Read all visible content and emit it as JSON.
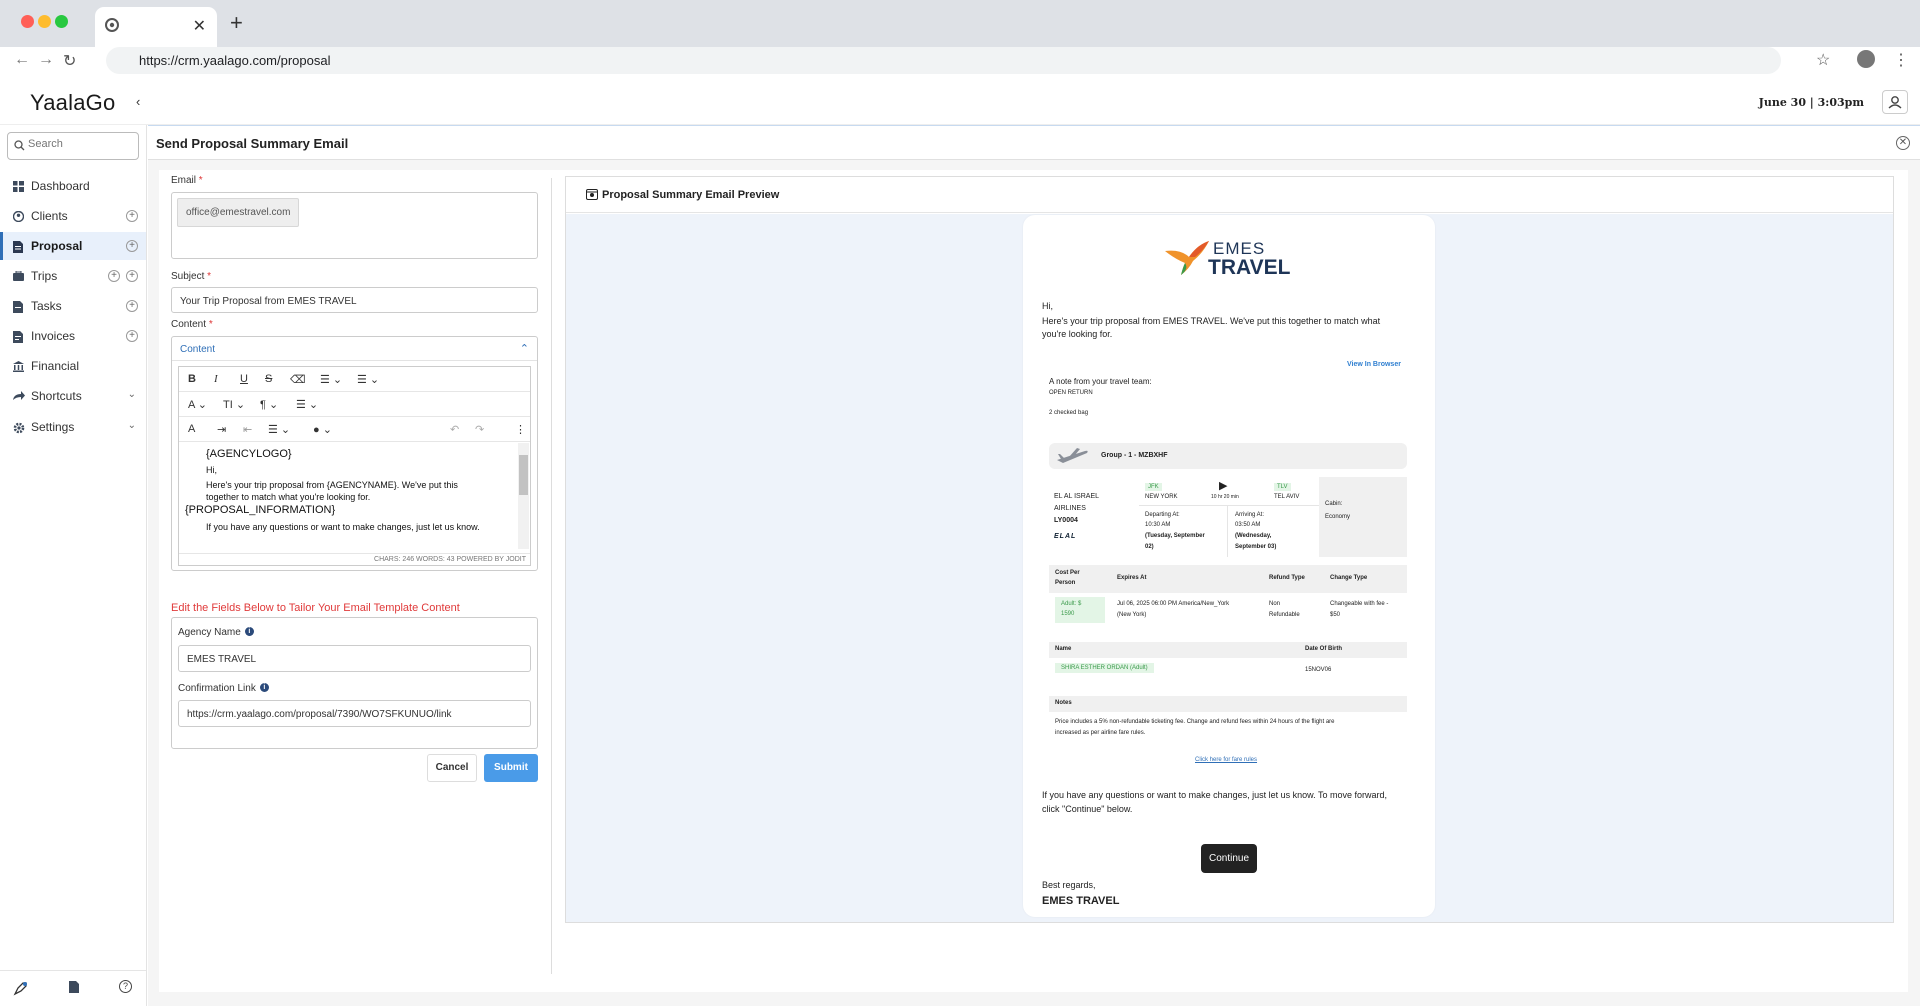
{
  "browser": {
    "url": "https://crm.yaalago.com/proposal"
  },
  "app": {
    "logo": "YaalaGo",
    "datetime": "June 30 | 3:03pm"
  },
  "sidebar": {
    "search_placeholder": "Search",
    "items": [
      {
        "label": "Dashboard"
      },
      {
        "label": "Clients"
      },
      {
        "label": "Proposal"
      },
      {
        "label": "Trips"
      },
      {
        "label": "Tasks"
      },
      {
        "label": "Invoices"
      },
      {
        "label": "Financial"
      },
      {
        "label": "Shortcuts"
      },
      {
        "label": "Settings"
      }
    ]
  },
  "page": {
    "title": "Send Proposal Summary Email"
  },
  "form": {
    "email_label": "Email",
    "email_value": "office@emestravel.com",
    "subject_label": "Subject",
    "subject_value": "Your Trip Proposal from EMES TRAVEL",
    "content_label": "Content",
    "content_section": "Content",
    "editor_lines": [
      "{AGENCYLOGO}",
      "Hi,",
      "Here's your trip proposal from {AGENCYNAME}. We've put this",
      "together to match what you're looking for.",
      "{PROPOSAL_INFORMATION}",
      "If you have any questions or want to make changes, just let us know."
    ],
    "editor_status": "CHARS: 246   WORDS: 43   POWERED BY JODIT",
    "tailor_heading": "Edit the Fields Below to Tailor Your Email Template Content",
    "agency_label": "Agency Name",
    "agency_value": "EMES TRAVEL",
    "link_label": "Confirmation Link",
    "link_value": "https://crm.yaalago.com/proposal/7390/WO7SFKUNUO/link",
    "cancel": "Cancel",
    "submit": "Submit"
  },
  "preview": {
    "title": "Proposal Summary Email Preview",
    "logo_top": "EMES",
    "logo_bottom": "TRAVEL",
    "greeting": "Hi,",
    "intro1": "Here's your trip proposal from EMES TRAVEL. We've put this together to match what",
    "intro2": "you're looking for.",
    "view_browser": "View In Browser",
    "note_title": "A note from your travel team:",
    "note1": "OPEN RETURN",
    "note2": "2 checked bag",
    "group": "Group - 1 - MZBXHF",
    "airline1": "EL AL ISRAEL",
    "airline2": "AIRLINES",
    "flight": "LY0004",
    "airline_logo": "ELAL",
    "from_code": "JFK",
    "from_city": "NEW YORK",
    "duration": "10 hr 20 min",
    "to_code": "TLV",
    "to_city": "TEL AVIV",
    "dep_label": "Departing At:",
    "dep_time": "10:30 AM",
    "dep_date1": "(Tuesday, September",
    "dep_date2": "02)",
    "arr_label": "Arriving At:",
    "arr_time": "03:50 AM",
    "arr_date1": "(Wednesday,",
    "arr_date2": "September 03)",
    "cabin_label": "Cabin:",
    "cabin": "Economy",
    "th_cost1": "Cost Per",
    "th_cost2": "Person",
    "th_expires": "Expires At",
    "th_refund": "Refund Type",
    "th_change": "Change Type",
    "cost1": "Adult: $",
    "cost2": "1590",
    "expires1": "Jul 06, 2025 06:00 PM America/New_York",
    "expires2": "(New York)",
    "refund1": "Non",
    "refund2": "Refundable",
    "change1": "Changeable with fee -",
    "change2": "$50",
    "th_name": "Name",
    "th_dob": "Date Of Birth",
    "passenger": "SHIRA ESTHER ORDAN (Adult)",
    "dob": "15NOV06",
    "notes_title": "Notes",
    "notes1": "Price includes a 5% non-refundable ticketing fee. Change and refund fees within 24 hours of the flight are",
    "notes2": "increased as per airline fare rules.",
    "fare_rules": "Click here for fare rules",
    "closing1": "If you have any questions or want to make changes, just let us know. To move forward,",
    "closing2": "click \"Continue\" below.",
    "continue": "Continue",
    "regards": "Best regards,",
    "signature": "EMES TRAVEL"
  }
}
